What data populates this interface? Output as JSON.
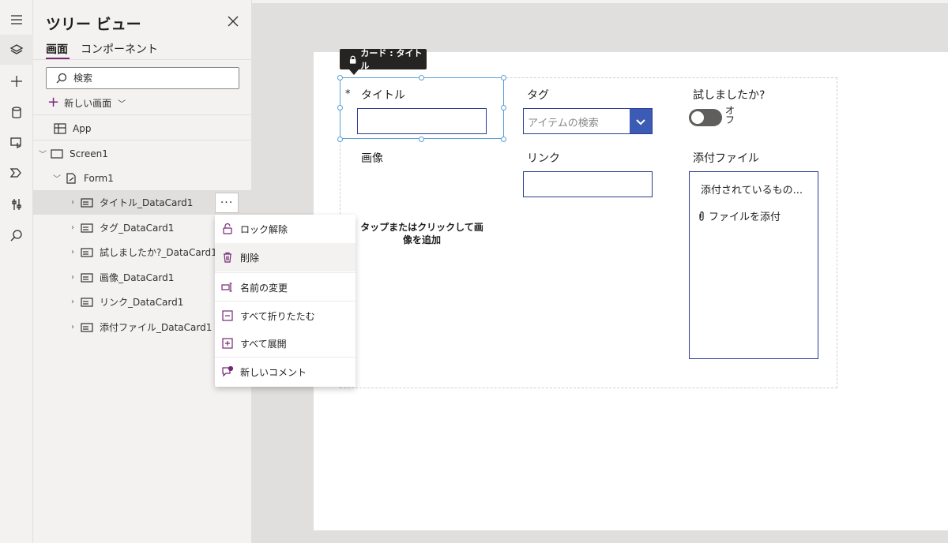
{
  "rail": {
    "items": [
      {
        "icon": "hamburger-icon"
      },
      {
        "icon": "layers-icon",
        "active": true
      },
      {
        "icon": "plus-icon"
      },
      {
        "icon": "database-icon"
      },
      {
        "icon": "media-icon"
      },
      {
        "icon": "power-automate-icon"
      },
      {
        "icon": "tools-icon"
      },
      {
        "icon": "search-icon"
      }
    ]
  },
  "tree": {
    "title": "ツリー ビュー",
    "tabs": [
      {
        "label": "画面",
        "active": true
      },
      {
        "label": "コンポーネント",
        "active": false
      }
    ],
    "search_placeholder": "検索",
    "new_screen_label": "新しい画面",
    "app_label": "App",
    "screen_label": "Screen1",
    "form_label": "Form1",
    "cards": [
      {
        "label": "タイトル_DataCard1",
        "selected": true
      },
      {
        "label": "タグ_DataCard1"
      },
      {
        "label": "試しましたか?_DataCard1"
      },
      {
        "label": "画像_DataCard1"
      },
      {
        "label": "リンク_DataCard1"
      },
      {
        "label": "添付ファイル_DataCard1"
      }
    ],
    "more_label": "···"
  },
  "context_menu": {
    "items": [
      {
        "label": "ロック解除",
        "icon": "lock-open-icon"
      },
      {
        "label": "削除",
        "icon": "trash-icon"
      },
      {
        "label": "名前の変更",
        "icon": "rename-icon"
      },
      {
        "label": "すべて折りたたむ",
        "icon": "collapse-all-icon"
      },
      {
        "label": "すべて展開",
        "icon": "expand-all-icon"
      },
      {
        "label": "新しいコメント",
        "icon": "comment-icon"
      }
    ]
  },
  "canvas": {
    "tooltip": "カード : タイトル",
    "fields": {
      "title_label": "タイトル",
      "required_star": "*",
      "tag_label": "タグ",
      "tag_placeholder": "アイテムの検索",
      "tried_label": "試しましたか?",
      "toggle_state": "オフ",
      "image_label": "画像",
      "image_hint": "タップまたはクリックして画像を追加",
      "link_label": "リンク",
      "attachments_label": "添付ファイル",
      "attachments_empty": "添付されているもの...",
      "attach_file": "ファイルを添付"
    }
  }
}
